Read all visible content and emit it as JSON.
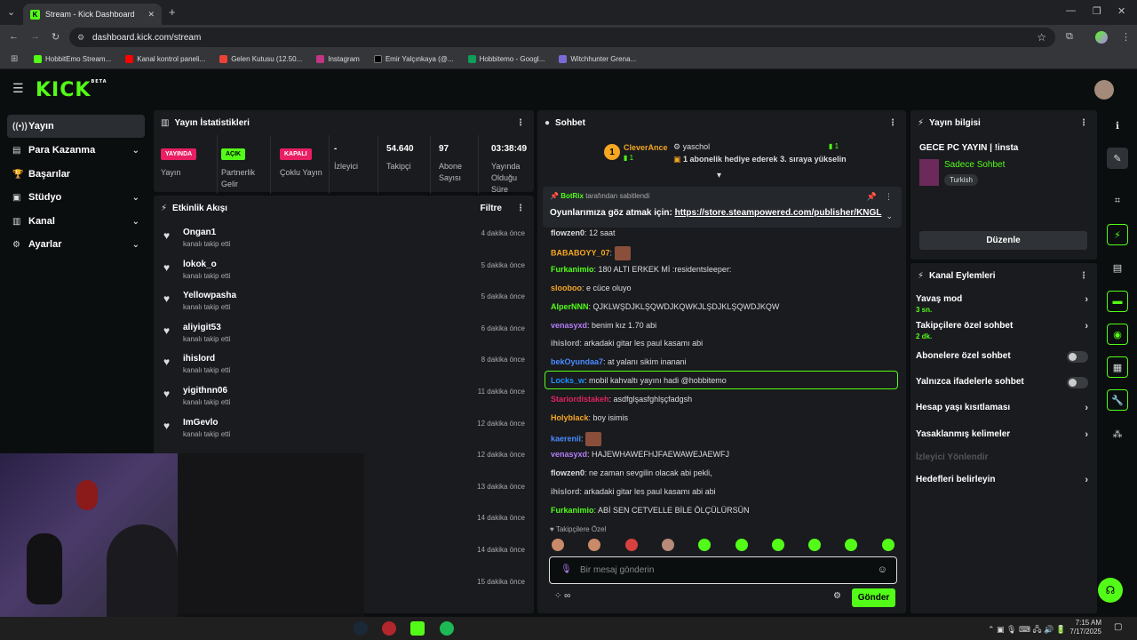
{
  "browser": {
    "tab_title": "Stream - Kick Dashboard",
    "url": "dashboard.kick.com/stream",
    "bookmarks": [
      "HobbitEmo Stream...",
      "Kanal kontrol paneli...",
      "Gelen Kutusu (12.50...",
      "Instagram",
      "Emir Yalçınkaya (@...",
      "Hobbitemo - Googl...",
      "Witchhunter Grena..."
    ]
  },
  "sidebar": {
    "items": [
      {
        "label": "Yayın",
        "icon": "broadcast-icon"
      },
      {
        "label": "Para Kazanma",
        "icon": "money-icon"
      },
      {
        "label": "Başarılar",
        "icon": "trophy-icon"
      },
      {
        "label": "Stüdyo",
        "icon": "studio-icon"
      },
      {
        "label": "Kanal",
        "icon": "channel-icon"
      },
      {
        "label": "Ayarlar",
        "icon": "gear-icon"
      }
    ]
  },
  "stats": {
    "title": "Yayın İstatistikleri",
    "items": [
      {
        "value": "YAYINDA",
        "label": "Yayın"
      },
      {
        "value": "AÇIK",
        "label": "Partnerlik Gelir"
      },
      {
        "value": "KAPALI",
        "label": "Çoklu Yayın"
      },
      {
        "value": "-",
        "label": "İzleyici"
      },
      {
        "value": "54.640",
        "label": "Takipçi"
      },
      {
        "value": "97",
        "label": "Abone Sayısı"
      },
      {
        "value": "03:38:49",
        "label": "Yayında Olduğu Süre"
      }
    ]
  },
  "activity": {
    "title": "Etkinlik Akışı",
    "filter_label": "Filtre",
    "items": [
      {
        "name": "Ongan1",
        "sub": "kanalı takip etti",
        "time": "4 dakika önce"
      },
      {
        "name": "lokok_o",
        "sub": "kanalı takip etti",
        "time": "5 dakika önce"
      },
      {
        "name": "Yellowpasha",
        "sub": "kanalı takip etti",
        "time": "5 dakika önce"
      },
      {
        "name": "aliyigit53",
        "sub": "kanalı takip etti",
        "time": "6 dakika önce"
      },
      {
        "name": "ihislord",
        "sub": "kanalı takip etti",
        "time": "8 dakika önce"
      },
      {
        "name": "yigithnn06",
        "sub": "kanalı takip etti",
        "time": "11 dakika önce"
      },
      {
        "name": "ImGevlo",
        "sub": "kanalı takip etti",
        "time": "12 dakika önce"
      },
      {
        "name": "",
        "sub": "",
        "time": "12 dakika önce"
      },
      {
        "name": "",
        "sub": "",
        "time": "13 dakika önce"
      },
      {
        "name": "",
        "sub": "",
        "time": "14 dakika önce"
      },
      {
        "name": "",
        "sub": "",
        "time": "14 dakika önce"
      },
      {
        "name": "",
        "sub": "",
        "time": "15 dakika önce"
      }
    ]
  },
  "chat": {
    "title": "Sohbet",
    "gift_top_user": "CleverAnce",
    "gift_top_count": "1",
    "gift_user": "yaschol",
    "gift_user_count": "1",
    "gift_message": "1 abonelik hediye ederek 3. sıraya yükselin",
    "pinned_by": "BotRix",
    "pinned_suffix": "tarafından sabitlendi",
    "pinned_text": "Oyunlarımıza göz atmak için:",
    "pinned_link": "https://store.steampowered.com/publisher/KNGL",
    "messages": [
      {
        "user": "flowzen0",
        "text": "12 saat",
        "color": "#dddddd"
      },
      {
        "user": "BABABOYY_07",
        "text": "",
        "color": "#f5a623",
        "emote": true
      },
      {
        "user": "Furkanimio",
        "text": "180 ALTI ERKEK Mİ :residentsleeper:",
        "color": "#53fc18"
      },
      {
        "user": "slooboo",
        "text": "e cüce oluyo",
        "color": "#f5a623"
      },
      {
        "user": "AlperNNN",
        "text": "QJKLWŞDJKLŞQWDJKQWKJLŞDJKLŞQWDJKQW",
        "color": "#53fc18"
      },
      {
        "user": "venasyxd",
        "text": "benim kız 1.70 abi",
        "color": "#b57cf7"
      },
      {
        "user": "ihislord",
        "text": "arkadaki gitar les paul kasamı abi",
        "color": "#aaaaaa"
      },
      {
        "user": "bekOyundaa7",
        "text": "at yalanı sikim inanani",
        "color": "#4a8cff"
      },
      {
        "user": "Locks_w",
        "text": "mobil kahvaltı yayını hadi @hobbitemo",
        "color": "#1e90ff"
      },
      {
        "user": "Stariordistakeh",
        "text": "asdfglşasfghlşçfadgsh",
        "color": "#e0245e"
      },
      {
        "user": "Holyblack",
        "text": "boy isimis",
        "color": "#f5a623"
      },
      {
        "user": "kaerenii",
        "text": "",
        "color": "#4a8cff",
        "emote": true
      },
      {
        "user": "venasyxd",
        "text": "HAJEWHAWEFHJFAEWAWEJAEWFJ",
        "color": "#b57cf7"
      },
      {
        "user": "flowzen0",
        "text": "ne zaman sevgilin olacak abi pekli,",
        "color": "#dddddd"
      },
      {
        "user": "ihislord",
        "text": "arkadaki gitar les paul kasamı abi abi",
        "color": "#aaaaaa"
      },
      {
        "user": "Furkanimio",
        "text": "ABİ SEN CETVELLE BİLE ÖLÇÜLÜRSÜN",
        "color": "#53fc18"
      }
    ],
    "followers_only_label": "Takipçilere Özel",
    "input_placeholder": "Bir mesaj gönderin",
    "send_label": "Gönder"
  },
  "stream_info": {
    "title": "Yayın bilgisi",
    "stream_title": "GECE PC YAYIN | !insta",
    "category": "Sadece Sohbet",
    "language": "Turkish",
    "edit_label": "Düzenle"
  },
  "channel_actions": {
    "title": "Kanal Eylemleri",
    "items": [
      {
        "label": "Yavaş mod",
        "sub": "3 sn.",
        "control": "arrow"
      },
      {
        "label": "Takipçilere özel sohbet",
        "sub": "2 dk.",
        "control": "arrow"
      },
      {
        "label": "Abonelere özel sohbet",
        "sub": "",
        "control": "toggle"
      },
      {
        "label": "Yalnızca ifadelerle sohbet",
        "sub": "",
        "control": "toggle"
      },
      {
        "label": "Hesap yaşı kısıtlaması",
        "sub": "",
        "control": "arrow"
      },
      {
        "label": "Yasaklanmış kelimeler",
        "sub": "",
        "control": "arrow"
      },
      {
        "label": "İzleyici Yönlendir",
        "sub": "",
        "control": "none"
      },
      {
        "label": "Hedefleri belirleyin",
        "sub": "",
        "control": "arrow"
      }
    ]
  },
  "taskbar": {
    "time": "7:15 AM",
    "date": "7/17/2025"
  },
  "colors": {
    "brand": "#53fc18",
    "live": "#e91e63",
    "panel": "#191b1f"
  }
}
